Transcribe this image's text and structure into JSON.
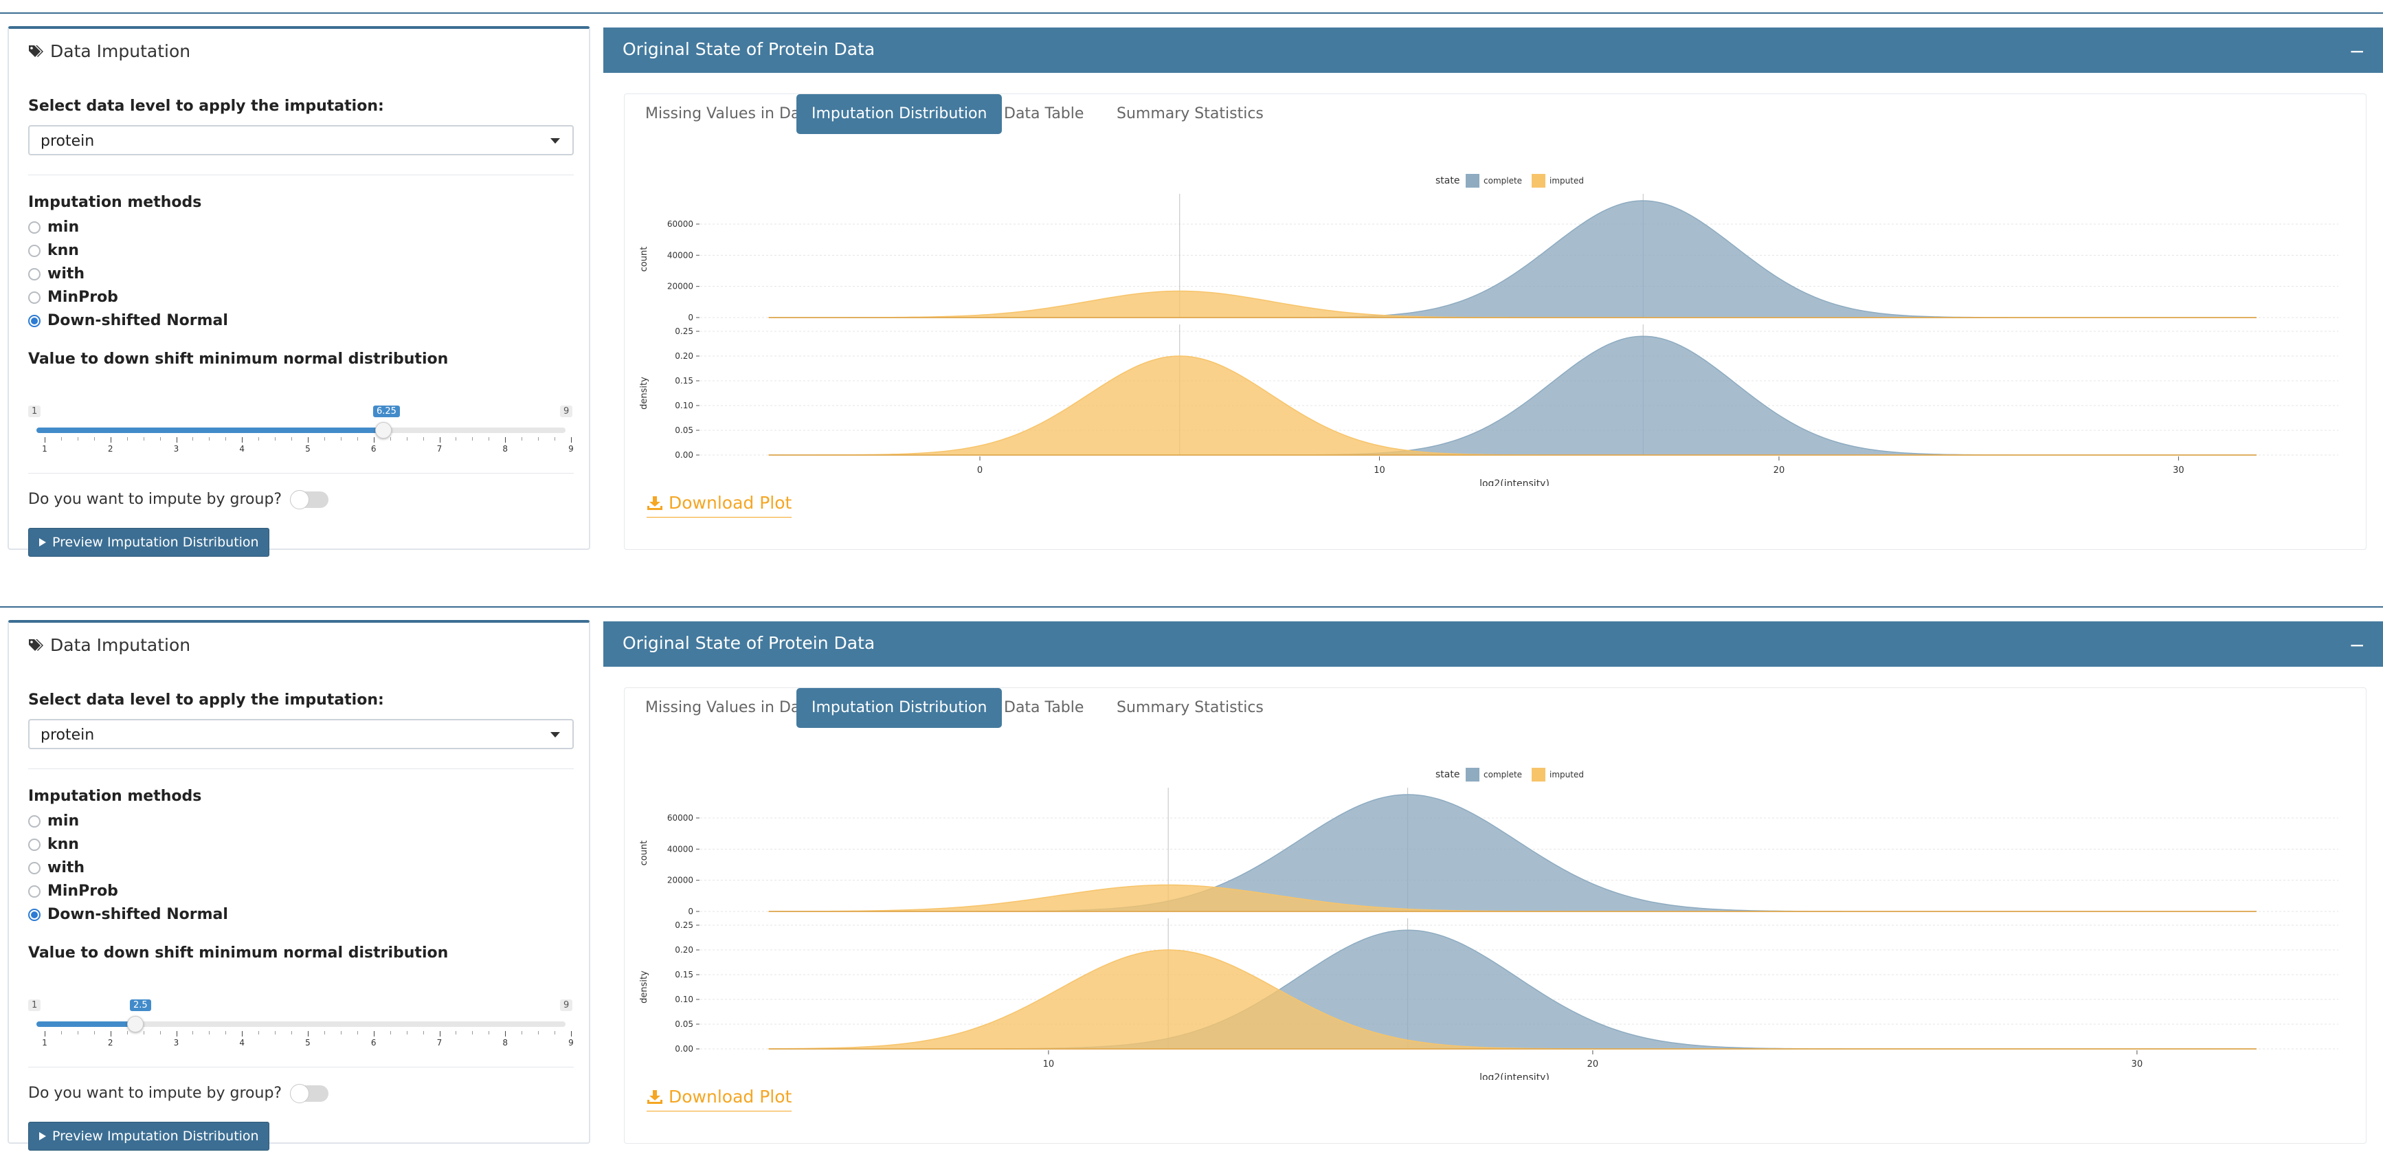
{
  "panels": [
    {
      "sidebar": {
        "title": "Data Imputation",
        "level_label": "Select data level to apply the imputation:",
        "level_value": "protein",
        "methods_label": "Imputation methods",
        "methods": [
          "min",
          "knn",
          "with",
          "MinProb",
          "Down-shifted Normal"
        ],
        "selected_method": "Down-shifted Normal",
        "slider_label": "Value to down shift minimum normal distribution",
        "slider_min": "1",
        "slider_max": "9",
        "slider_value": "6.25",
        "slider_ticks": [
          "1",
          "2",
          "3",
          "4",
          "5",
          "6",
          "7",
          "8",
          "9"
        ],
        "group_label": "Do you want to impute by group?",
        "group_toggle": false,
        "preview_button": "Preview Imputation Distribution"
      },
      "main": {
        "title": "Original State of Protein Data",
        "collapse": "−",
        "tabs": [
          "Missing Values in Data",
          "Imputation Distribution",
          "Data Table",
          "Summary Statistics"
        ],
        "active_tab": "Imputation Distribution",
        "download": "Download Plot"
      },
      "chart_data": {
        "type": "area",
        "legend_title": "state",
        "legend": [
          "complete",
          "imputed"
        ],
        "xlabel": "log2(intensity)",
        "xlim": [
          -7,
          34
        ],
        "xticks": [
          "0",
          "10",
          "20",
          "30"
        ],
        "facets": [
          {
            "ylabel": "count",
            "ylim": [
              0,
              75000
            ],
            "yticks": [
              "0",
              "20000",
              "40000",
              "60000"
            ],
            "series": [
              {
                "name": "complete",
                "color": "#8eabc0",
                "mean": 16.6,
                "sd": 2.3,
                "peak": 75000
              },
              {
                "name": "imputed",
                "color": "#f7c46a",
                "mean": 5.0,
                "sd": 2.3,
                "peak": 17000
              }
            ],
            "vlines": [
              5.0,
              16.6
            ]
          },
          {
            "ylabel": "density",
            "ylim": [
              0,
              0.25
            ],
            "yticks": [
              "0.00",
              "0.05",
              "0.10",
              "0.15",
              "0.20",
              "0.25"
            ],
            "series": [
              {
                "name": "complete",
                "color": "#8eabc0",
                "mean": 16.6,
                "sd": 2.3,
                "peak": 0.24
              },
              {
                "name": "imputed",
                "color": "#f7c46a",
                "mean": 5.0,
                "sd": 2.3,
                "peak": 0.2
              }
            ],
            "vlines": [
              5.0,
              16.6
            ]
          }
        ]
      }
    },
    {
      "sidebar": {
        "title": "Data Imputation",
        "level_label": "Select data level to apply the imputation:",
        "level_value": "protein",
        "methods_label": "Imputation methods",
        "methods": [
          "min",
          "knn",
          "with",
          "MinProb",
          "Down-shifted Normal"
        ],
        "selected_method": "Down-shifted Normal",
        "slider_label": "Value to down shift minimum normal distribution",
        "slider_min": "1",
        "slider_max": "9",
        "slider_value": "2.5",
        "slider_ticks": [
          "1",
          "2",
          "3",
          "4",
          "5",
          "6",
          "7",
          "8",
          "9"
        ],
        "group_label": "Do you want to impute by group?",
        "group_toggle": false,
        "preview_button": "Preview Imputation Distribution"
      },
      "main": {
        "title": "Original State of Protein Data",
        "collapse": "−",
        "tabs": [
          "Missing Values in Data",
          "Imputation Distribution",
          "Data Table",
          "Summary Statistics"
        ],
        "active_tab": "Imputation Distribution",
        "download": "Download Plot"
      },
      "chart_data": {
        "type": "area",
        "legend_title": "state",
        "legend": [
          "complete",
          "imputed"
        ],
        "xlabel": "log2(intensity)",
        "xlim": [
          3.6,
          33.7
        ],
        "xticks": [
          "10",
          "20",
          "30"
        ],
        "facets": [
          {
            "ylabel": "count",
            "ylim": [
              0,
              75000
            ],
            "yticks": [
              "0",
              "20000",
              "40000",
              "60000"
            ],
            "series": [
              {
                "name": "complete",
                "color": "#8eabc0",
                "mean": 16.6,
                "sd": 2.0,
                "peak": 75000
              },
              {
                "name": "imputed",
                "color": "#f7c46a",
                "mean": 12.2,
                "sd": 2.0,
                "peak": 17000
              }
            ],
            "vlines": [
              12.2,
              16.6
            ]
          },
          {
            "ylabel": "density",
            "ylim": [
              0,
              0.25
            ],
            "yticks": [
              "0.00",
              "0.05",
              "0.10",
              "0.15",
              "0.20",
              "0.25"
            ],
            "series": [
              {
                "name": "complete",
                "color": "#8eabc0",
                "mean": 16.6,
                "sd": 2.0,
                "peak": 0.24
              },
              {
                "name": "imputed",
                "color": "#f7c46a",
                "mean": 12.2,
                "sd": 2.0,
                "peak": 0.2
              }
            ],
            "vlines": [
              12.2,
              16.6
            ]
          }
        ]
      }
    }
  ]
}
